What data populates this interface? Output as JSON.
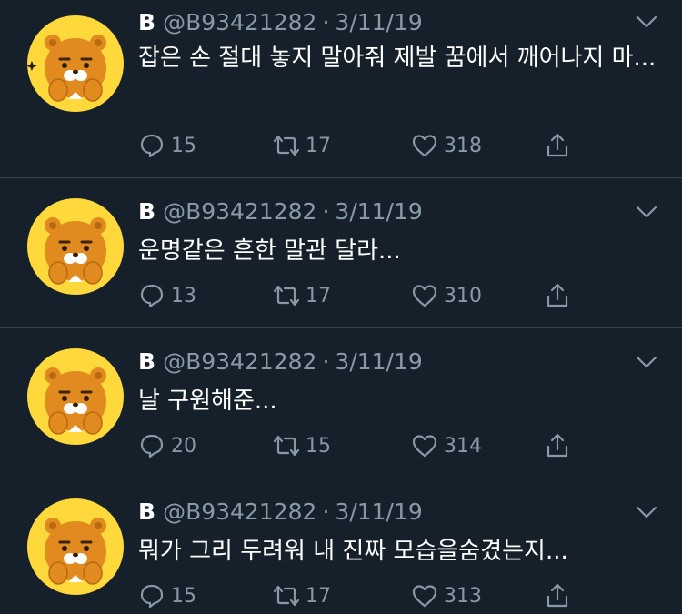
{
  "colors": {
    "background": "#15202b",
    "divider": "#38444d",
    "muted": "#8899a6",
    "text": "#ffffff"
  },
  "tweets": [
    {
      "name": "B",
      "handle": "@B93421282",
      "separator": "·",
      "date": "3/11/19",
      "text": "잡은 손 절대 놓지 말아줘 제발 꿈에서 깨어나지 마...",
      "replies": "15",
      "retweets": "17",
      "likes": "318",
      "avatar_icon": "ryan-character-avatar"
    },
    {
      "name": "B",
      "handle": "@B93421282",
      "separator": "·",
      "date": "3/11/19",
      "text": "운명같은 흔한 말관 달라...",
      "replies": "13",
      "retweets": "17",
      "likes": "310",
      "avatar_icon": "ryan-character-avatar"
    },
    {
      "name": "B",
      "handle": "@B93421282",
      "separator": "·",
      "date": "3/11/19",
      "text": "날 구원해준...",
      "replies": "20",
      "retweets": "15",
      "likes": "314",
      "avatar_icon": "ryan-character-avatar"
    },
    {
      "name": "B",
      "handle": "@B93421282",
      "separator": "·",
      "date": "3/11/19",
      "text": "뭐가 그리 두려워 내 진짜 모습을숨겼는지...",
      "replies": "15",
      "retweets": "17",
      "likes": "313",
      "avatar_icon": "ryan-character-avatar"
    }
  ]
}
